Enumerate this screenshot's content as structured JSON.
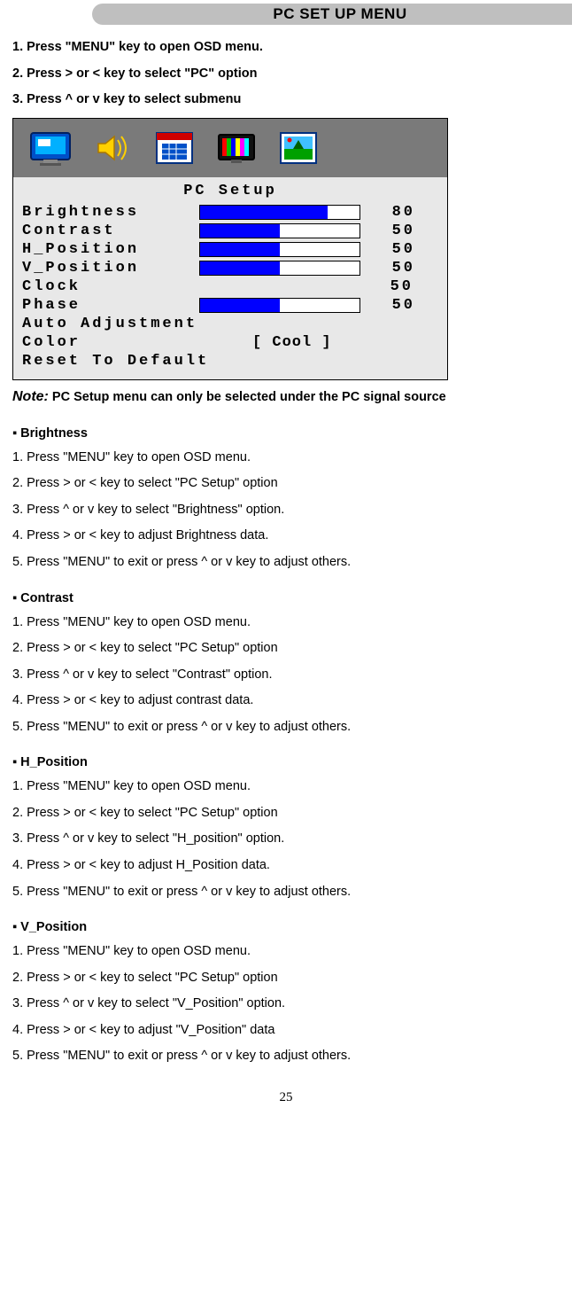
{
  "header": {
    "title": "PC SET UP MENU"
  },
  "intro_steps": [
    "1. Press \"MENU\" key to open OSD menu.",
    "2. Press > or < key to select \"PC\" option",
    "3. Press ^ or v key to select submenu"
  ],
  "osd": {
    "title": "PC  Setup",
    "rows": [
      {
        "label": "Brightness",
        "value": 80,
        "bar": 80
      },
      {
        "label": "Contrast",
        "value": 50,
        "bar": 50
      },
      {
        "label": "H_Position",
        "value": 50,
        "bar": 50
      },
      {
        "label": "V_Position",
        "value": 50,
        "bar": 50
      },
      {
        "label": "Clock",
        "value": 50,
        "bar": null
      },
      {
        "label": "Phase",
        "value": 50,
        "bar": 50
      }
    ],
    "extra_rows": [
      "Auto Adjustment",
      "Color",
      "Reset To Default"
    ],
    "color_value": "[   Cool   ]"
  },
  "note": {
    "prefix": "Note:",
    "text": "PC Setup menu can only be selected under the PC signal source"
  },
  "sections": [
    {
      "heading": "▪ Brightness",
      "steps": [
        "1. Press \"MENU\" key to open OSD menu.",
        "2. Press > or < key to select \"PC Setup\" option",
        "3. Press ^ or v key to select \"Brightness\" option.",
        "4. Press > or < key to adjust Brightness data.",
        "5. Press \"MENU\" to exit or press ^ or v key to adjust others."
      ]
    },
    {
      "heading": "▪ Contrast",
      "steps": [
        "1. Press \"MENU\" key to open OSD menu.",
        "2. Press > or < key to select \"PC Setup\" option",
        "3. Press ^ or v key to select \"Contrast\" option.",
        "4. Press > or < key to adjust contrast data.",
        "5. Press \"MENU\" to exit or press ^ or v key to adjust others."
      ]
    },
    {
      "heading": "▪ H_Position",
      "steps": [
        "1. Press \"MENU\" key to open OSD menu.",
        "2. Press > or < key to select \"PC Setup\" option",
        "3. Press ^ or v key to select \"H_position\" option.",
        "4. Press > or < key to adjust H_Position data.",
        "5. Press \"MENU\" to exit or press ^ or v key to adjust others."
      ]
    },
    {
      "heading": "▪ V_Position",
      "steps": [
        "1. Press \"MENU\" key to open OSD menu.",
        "2. Press > or < key to select \"PC Setup\" option",
        "3. Press ^ or v key to select \"V_Position\" option.",
        "4. Press > or < key to adjust \"V_Position\" data",
        "5. Press \"MENU\" to exit or press ^ or v key to adjust others."
      ]
    }
  ],
  "page_number": "25"
}
